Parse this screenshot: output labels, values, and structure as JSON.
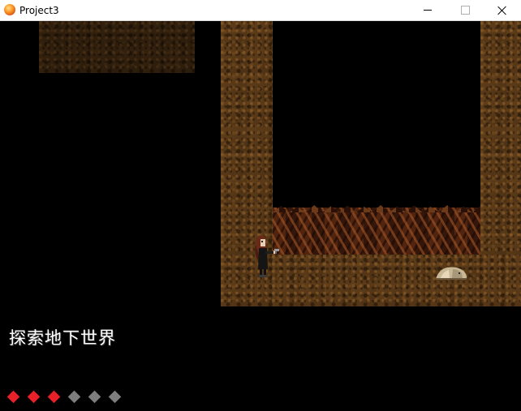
{
  "window": {
    "title": "Project3",
    "controls": {
      "minimize": "minimize",
      "maximize": "maximize",
      "close": "close"
    }
  },
  "game": {
    "area_caption": "探索地下世界",
    "health": {
      "max": 6,
      "current": 3,
      "full_color": "#e8202a",
      "empty_color": "#7d7d7d"
    },
    "entities": [
      {
        "name": "player",
        "facing": "right",
        "holding": "pistol"
      },
      {
        "name": "critter",
        "type": "pale grub"
      }
    ],
    "colors": {
      "background": "#000000",
      "dirt": "#5a3a18",
      "ore_wall": "#3a1a0c",
      "caption": "#ffffff"
    }
  }
}
